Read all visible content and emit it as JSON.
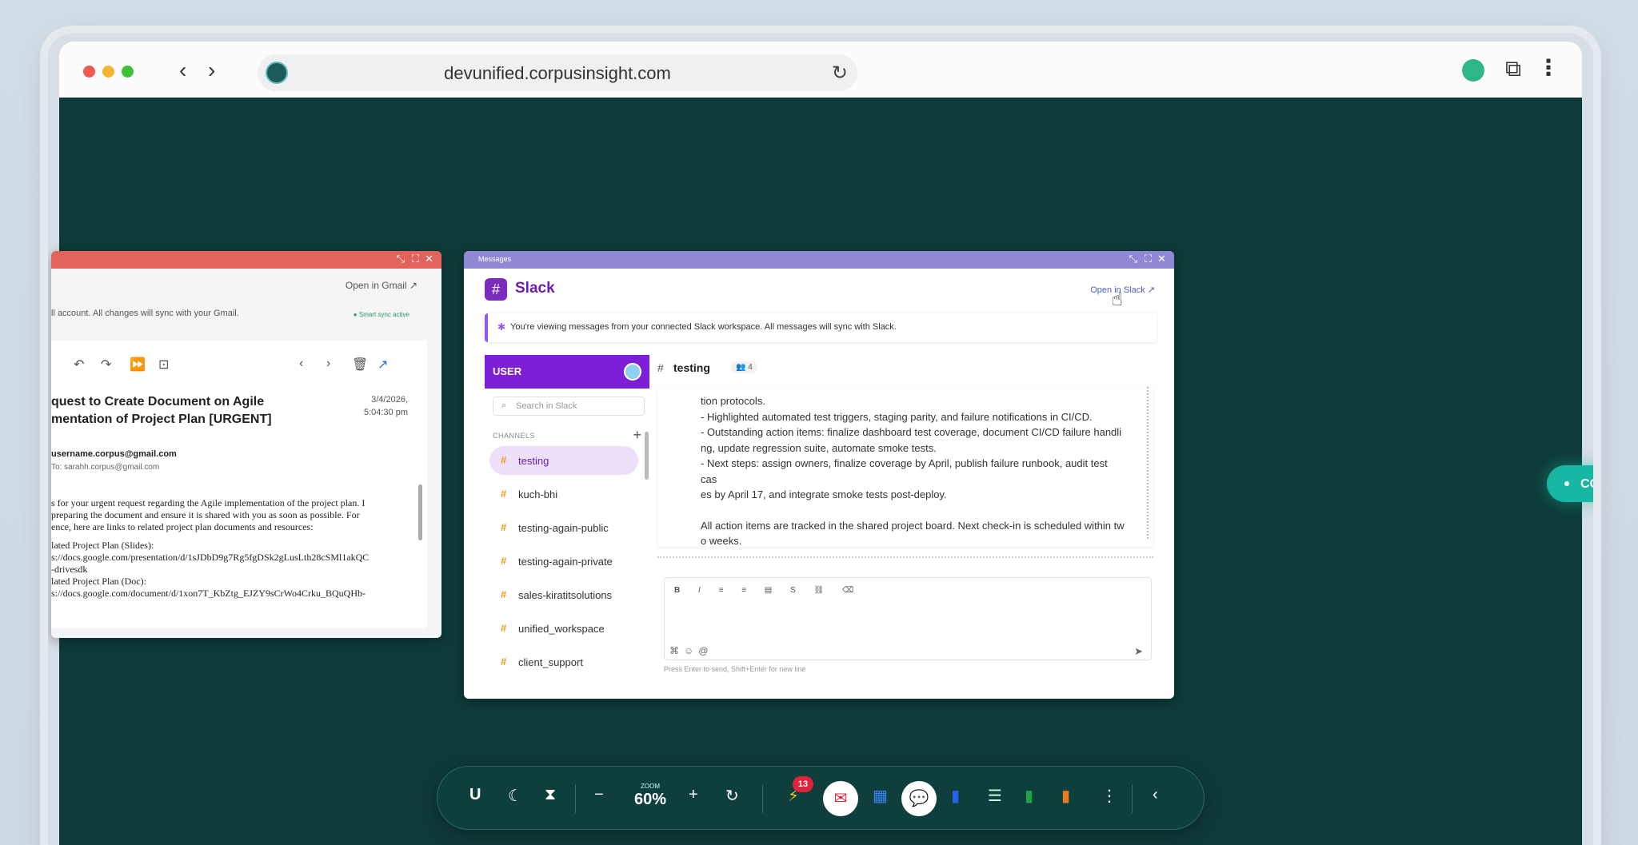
{
  "browser": {
    "url": "devunified.corpusinsight.com"
  },
  "gmail": {
    "open_link": "Open in Gmail",
    "notice": "ll account. All changes will sync with your Gmail.",
    "sync_status": "Smart sync active",
    "subject_line1": "quest to Create Document on Agile",
    "subject_line2": "mentation of Project Plan [URGENT]",
    "date_line1": "3/4/2026,",
    "date_line2": "5:04:30 pm",
    "from": "username.corpus@gmail.com",
    "to": "To: sarahh.corpus@gmail.com",
    "body_lines": [
      "s for your urgent request regarding the Agile implementation of the project plan. I",
      "preparing the document and ensure it is shared with you as soon as possible. For",
      "ence, here are links to related project plan documents and resources:",
      "",
      "lated Project Plan (Slides):",
      "s://docs.google.com/presentation/d/1sJDbD9g7Rg5fgDSk2gLusLth28cSMl1akQC",
      "-drivesdk",
      "lated Project Plan (Doc):",
      "s://docs.google.com/document/d/1xon7T_KbZtg_EJZY9sCrWo4Crku_BQuQHb-"
    ]
  },
  "slack": {
    "window_label": "Messages",
    "title": "Slack",
    "open_link": "Open in Slack",
    "banner": "You're viewing messages from your connected Slack workspace. All messages will sync with Slack.",
    "user_label": "USER",
    "search_placeholder": "Search in Slack",
    "channels_header": "CHANNELS",
    "channels": [
      {
        "name": "testing"
      },
      {
        "name": "kuch-bhi"
      },
      {
        "name": "testing-again-public"
      },
      {
        "name": "testing-again-private"
      },
      {
        "name": "sales-kiratitsolutions"
      },
      {
        "name": "unified_workspace"
      },
      {
        "name": "client_support"
      }
    ],
    "active_channel": "testing",
    "member_count": "4",
    "message_lines": [
      "tion protocols.",
      "- Highlighted automated test triggers, staging parity, and failure notifications in CI/CD.",
      "- Outstanding action items: finalize dashboard test coverage, document CI/CD failure handli",
      "ng, update regression suite, automate smoke tests.",
      "- Next steps: assign owners, finalize coverage by April, publish failure runbook, audit test cas",
      "es by April 17, and integrate smoke tests post-deploy.",
      "",
      "All action items are tracked in the shared project board. Next check-in is scheduled within tw",
      "o weeks."
    ],
    "composer_hint": "Press Enter to send, Shift+Enter for new line"
  },
  "cosi": {
    "label": "COSI"
  },
  "dock": {
    "user_initial": "U",
    "zoom_label": "ZOOM",
    "zoom_value": "60%",
    "notification_count": "13"
  }
}
